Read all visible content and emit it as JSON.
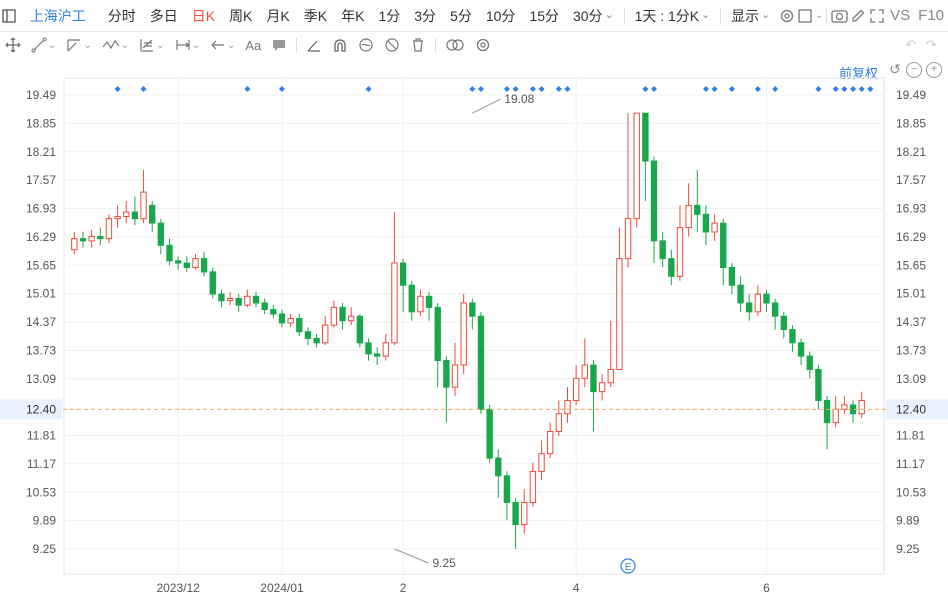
{
  "header": {
    "stock_name": "上海沪工",
    "period_tabs": [
      "分时",
      "多日",
      "日K",
      "周K",
      "月K",
      "季K",
      "年K",
      "1分",
      "3分",
      "5分",
      "10分",
      "15分",
      "30分"
    ],
    "active_tab_index": 2,
    "combo_label": "1天 : 1分K",
    "display_label": "显示",
    "vs_label": "VS",
    "f10_label": "F10"
  },
  "toolbar2": {
    "text_tool_label": "Aa"
  },
  "fuquan_label": "前复权",
  "colors": {
    "up": "#f04b3c",
    "down": "#1aa64a",
    "price_line": "#f5a65b",
    "price_label_bg": "#e8f2ff",
    "event_marker": "#2f80ed",
    "accent": "#2f80ed"
  },
  "chart_data": {
    "type": "candlestick",
    "y_ticks": [
      "19.49",
      "18.85",
      "18.21",
      "17.57",
      "16.93",
      "16.29",
      "15.65",
      "15.01",
      "14.37",
      "13.73",
      "13.09",
      "12.40",
      "11.81",
      "11.17",
      "10.53",
      "9.89",
      "9.25"
    ],
    "y_tick_values": [
      19.49,
      18.85,
      18.21,
      17.57,
      16.93,
      16.29,
      15.65,
      15.01,
      14.37,
      13.73,
      13.09,
      12.45,
      11.81,
      11.17,
      10.53,
      9.89,
      9.25
    ],
    "ylim": [
      8.6,
      20.0
    ],
    "x_labels": [
      {
        "label": "2023/12",
        "index": 12
      },
      {
        "label": "2024/01",
        "index": 24
      },
      {
        "label": "2",
        "index": 38
      },
      {
        "label": "4",
        "index": 58
      },
      {
        "label": "6",
        "index": 80
      }
    ],
    "current_price": 12.4,
    "high_label": {
      "value": "19.08",
      "index": 46
    },
    "low_label": {
      "value": "9.25",
      "index": 37
    },
    "event_marker_label": "E",
    "event_marker_index": 64,
    "event_dots": [
      5,
      8,
      20,
      24,
      34,
      46,
      47,
      50,
      51,
      53,
      54,
      56,
      57,
      66,
      67,
      73,
      74,
      76,
      79,
      81,
      86,
      88,
      89,
      90,
      91,
      92
    ],
    "candles": [
      [
        16.0,
        16.25,
        16.4,
        15.9
      ],
      [
        16.25,
        16.2,
        16.4,
        16.05
      ],
      [
        16.2,
        16.3,
        16.45,
        16.05
      ],
      [
        16.3,
        16.25,
        16.5,
        16.1
      ],
      [
        16.25,
        16.7,
        16.8,
        16.15
      ],
      [
        16.7,
        16.75,
        17.0,
        16.5
      ],
      [
        16.75,
        16.85,
        17.1,
        16.6
      ],
      [
        16.85,
        16.7,
        17.2,
        16.55
      ],
      [
        16.7,
        17.3,
        17.8,
        16.6
      ],
      [
        17.0,
        16.6,
        17.1,
        16.4
      ],
      [
        16.6,
        16.1,
        16.7,
        15.9
      ],
      [
        16.1,
        15.75,
        16.25,
        15.65
      ],
      [
        15.75,
        15.7,
        15.85,
        15.55
      ],
      [
        15.7,
        15.6,
        15.85,
        15.5
      ],
      [
        15.6,
        15.8,
        15.9,
        15.55
      ],
      [
        15.8,
        15.5,
        15.95,
        15.4
      ],
      [
        15.5,
        15.0,
        15.6,
        14.9
      ],
      [
        15.0,
        14.85,
        15.1,
        14.7
      ],
      [
        14.85,
        14.9,
        15.05,
        14.75
      ],
      [
        14.9,
        14.75,
        15.0,
        14.6
      ],
      [
        14.75,
        14.95,
        15.1,
        14.7
      ],
      [
        14.95,
        14.8,
        15.05,
        14.7
      ],
      [
        14.8,
        14.65,
        14.9,
        14.55
      ],
      [
        14.65,
        14.55,
        14.75,
        14.45
      ],
      [
        14.55,
        14.35,
        14.65,
        14.25
      ],
      [
        14.35,
        14.45,
        14.55,
        14.25
      ],
      [
        14.45,
        14.15,
        14.55,
        14.05
      ],
      [
        14.15,
        14.0,
        14.25,
        13.85
      ],
      [
        14.0,
        13.9,
        14.1,
        13.8
      ],
      [
        13.9,
        14.3,
        14.5,
        13.85
      ],
      [
        14.3,
        14.7,
        14.85,
        14.25
      ],
      [
        14.7,
        14.4,
        14.8,
        14.2
      ],
      [
        14.4,
        14.5,
        14.7,
        14.3
      ],
      [
        14.5,
        13.9,
        14.55,
        13.8
      ],
      [
        13.9,
        13.65,
        14.0,
        13.5
      ],
      [
        13.65,
        13.6,
        13.8,
        13.4
      ],
      [
        13.6,
        13.9,
        14.1,
        13.5
      ],
      [
        13.9,
        15.7,
        16.85,
        13.85
      ],
      [
        15.7,
        15.2,
        15.8,
        14.6
      ],
      [
        15.2,
        14.6,
        15.3,
        14.4
      ],
      [
        14.6,
        14.95,
        15.1,
        14.5
      ],
      [
        14.95,
        14.7,
        15.05,
        14.4
      ],
      [
        14.7,
        13.5,
        14.8,
        12.9
      ],
      [
        13.5,
        12.9,
        13.6,
        12.1
      ],
      [
        12.9,
        13.4,
        13.9,
        12.7
      ],
      [
        13.4,
        14.8,
        15.0,
        13.2
      ],
      [
        14.8,
        14.5,
        14.9,
        14.2
      ],
      [
        14.5,
        12.4,
        14.6,
        12.3
      ],
      [
        12.4,
        11.3,
        12.5,
        11.2
      ],
      [
        11.3,
        10.9,
        11.5,
        10.4
      ],
      [
        10.9,
        10.3,
        11.0,
        9.9
      ],
      [
        10.3,
        9.8,
        10.4,
        9.25
      ],
      [
        9.8,
        10.3,
        10.6,
        9.6
      ],
      [
        10.3,
        11.0,
        11.2,
        10.2
      ],
      [
        11.0,
        11.4,
        11.7,
        10.8
      ],
      [
        11.4,
        11.9,
        12.1,
        11.3
      ],
      [
        11.9,
        12.3,
        12.6,
        11.8
      ],
      [
        12.3,
        12.6,
        12.9,
        12.1
      ],
      [
        12.6,
        13.1,
        13.4,
        12.5
      ],
      [
        13.1,
        13.4,
        14.0,
        12.9
      ],
      [
        13.4,
        12.8,
        13.5,
        11.9
      ],
      [
        12.8,
        13.0,
        13.2,
        12.6
      ],
      [
        13.0,
        13.3,
        14.4,
        12.9
      ],
      [
        13.3,
        15.8,
        16.5,
        15.5
      ],
      [
        15.8,
        16.7,
        19.08,
        15.6
      ],
      [
        16.7,
        19.08,
        19.08,
        16.5
      ],
      [
        19.08,
        18.0,
        19.0,
        17.1
      ],
      [
        18.0,
        16.2,
        18.1,
        15.7
      ],
      [
        16.2,
        15.8,
        16.4,
        15.6
      ],
      [
        15.8,
        15.4,
        16.0,
        15.2
      ],
      [
        15.4,
        16.5,
        17.0,
        15.3
      ],
      [
        16.5,
        17.0,
        17.5,
        16.3
      ],
      [
        17.0,
        16.8,
        17.8,
        16.4
      ],
      [
        16.8,
        16.4,
        17.0,
        16.1
      ],
      [
        16.4,
        16.6,
        16.8,
        16.2
      ],
      [
        16.6,
        15.6,
        16.7,
        15.2
      ],
      [
        15.6,
        15.2,
        15.7,
        15.0
      ],
      [
        15.2,
        14.8,
        15.4,
        14.6
      ],
      [
        14.8,
        14.6,
        15.0,
        14.4
      ],
      [
        14.6,
        15.0,
        15.2,
        14.5
      ],
      [
        15.0,
        14.8,
        15.1,
        14.6
      ],
      [
        14.8,
        14.5,
        14.9,
        14.2
      ],
      [
        14.5,
        14.2,
        14.6,
        14.0
      ],
      [
        14.2,
        13.9,
        14.3,
        13.7
      ],
      [
        13.9,
        13.6,
        14.0,
        13.4
      ],
      [
        13.6,
        13.3,
        13.7,
        13.1
      ],
      [
        13.3,
        12.6,
        13.4,
        12.4
      ],
      [
        12.6,
        12.1,
        12.7,
        11.5
      ],
      [
        12.1,
        12.4,
        12.7,
        12.0
      ],
      [
        12.4,
        12.5,
        12.7,
        12.3
      ],
      [
        12.5,
        12.3,
        12.6,
        12.1
      ],
      [
        12.3,
        12.6,
        12.8,
        12.2
      ]
    ]
  }
}
